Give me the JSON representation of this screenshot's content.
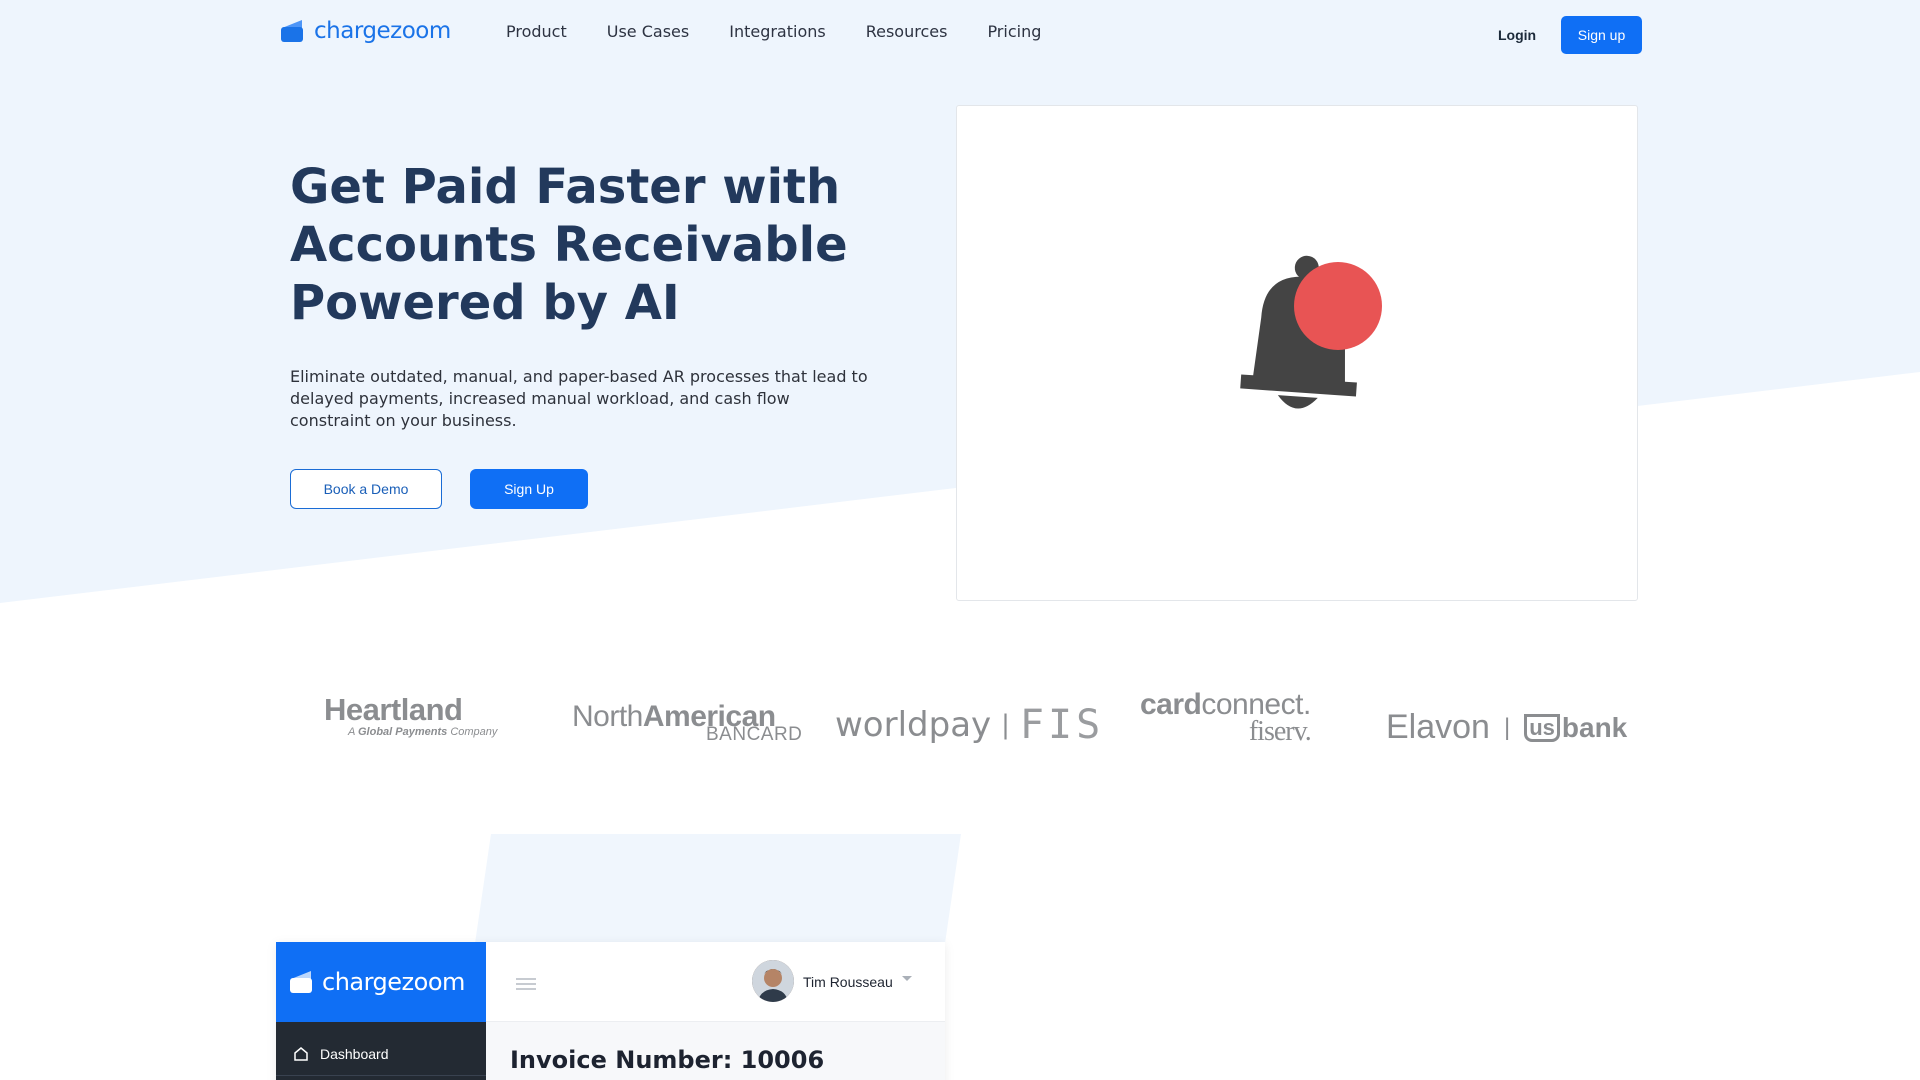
{
  "nav": {
    "logo_text": "chargezoom",
    "links": [
      "Product",
      "Use Cases",
      "Integrations",
      "Resources",
      "Pricing"
    ],
    "login": "Login",
    "signup": "Sign up"
  },
  "hero": {
    "title": "Get Paid Faster with Accounts Receivable Powered by AI",
    "subtitle": "Eliminate outdated, manual, and paper-based AR processes that lead to delayed payments, increased manual workload, and cash flow constraint on your business.",
    "btn_demo": "Book a Demo",
    "btn_signup": "Sign Up"
  },
  "partners": {
    "heartland": {
      "name": "Heartland",
      "tag_prefix": "A",
      "tag_bold": "Global Payments",
      "tag_suffix": "Company"
    },
    "nab": {
      "north": "North",
      "american": "American",
      "bancard": "BANCARD"
    },
    "worldpay": {
      "name": "worldpay",
      "sep": "|",
      "fis": "FIS"
    },
    "cardconnect": {
      "card": "card",
      "connect": "connect.",
      "fiserv": "fiserv."
    },
    "elavon": {
      "name": "Elavon",
      "sep": "|",
      "us": "us",
      "bank": "bank"
    }
  },
  "dashboard": {
    "logo_text": "chargezoom",
    "nav_item": "Dashboard",
    "user_name": "Tim Rousseau",
    "invoice_title": "Invoice Number: 10006"
  },
  "colors": {
    "brand_blue": "#0f6ff5",
    "heading_navy": "#22395c",
    "hero_bg": "#eef5fd",
    "bell_dark": "#444444",
    "bell_badge": "#e85454"
  },
  "icons": [
    "chargezoom-logo-icon",
    "notification-bell-icon",
    "home-icon",
    "menu-icon",
    "caret-down-icon"
  ]
}
